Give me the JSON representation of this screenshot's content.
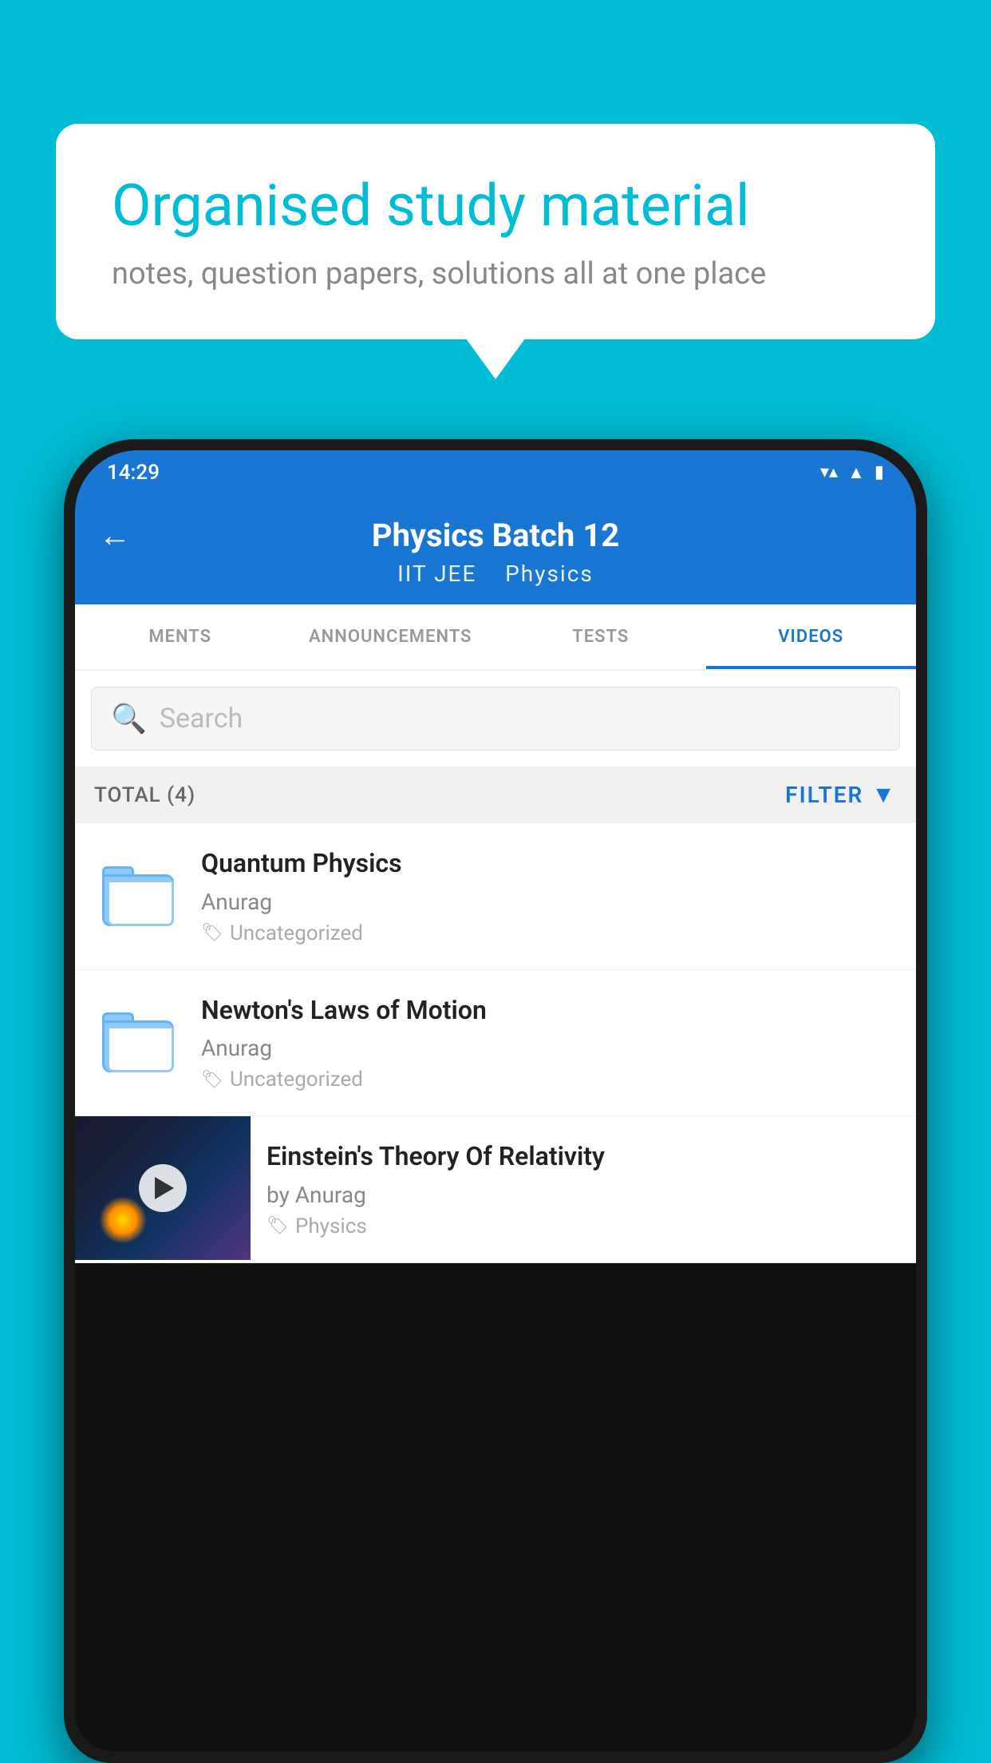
{
  "page": {
    "background_color": "#00BCD4"
  },
  "speech_bubble": {
    "title": "Organised study material",
    "subtitle": "notes, question papers, solutions all at one place"
  },
  "phone": {
    "status_bar": {
      "time": "14:29",
      "wifi_icon": "▼",
      "signal_icon": "▲",
      "battery_icon": "▮"
    },
    "app_bar": {
      "back_label": "←",
      "title": "Physics Batch 12",
      "subtitle_parts": [
        "IIT JEE",
        "Physics"
      ]
    },
    "tabs": [
      {
        "label": "MENTS",
        "active": false
      },
      {
        "label": "ANNOUNCEMENTS",
        "active": false
      },
      {
        "label": "TESTS",
        "active": false
      },
      {
        "label": "VIDEOS",
        "active": true
      }
    ],
    "search": {
      "placeholder": "Search"
    },
    "filter_row": {
      "total_label": "TOTAL (4)",
      "filter_label": "FILTER"
    },
    "video_items": [
      {
        "title": "Quantum Physics",
        "author": "Anurag",
        "tag": "Uncategorized",
        "type": "folder"
      },
      {
        "title": "Newton's Laws of Motion",
        "author": "Anurag",
        "tag": "Uncategorized",
        "type": "folder"
      },
      {
        "title": "Einstein's Theory Of Relativity",
        "author": "by Anurag",
        "tag": "Physics",
        "type": "video"
      }
    ]
  }
}
